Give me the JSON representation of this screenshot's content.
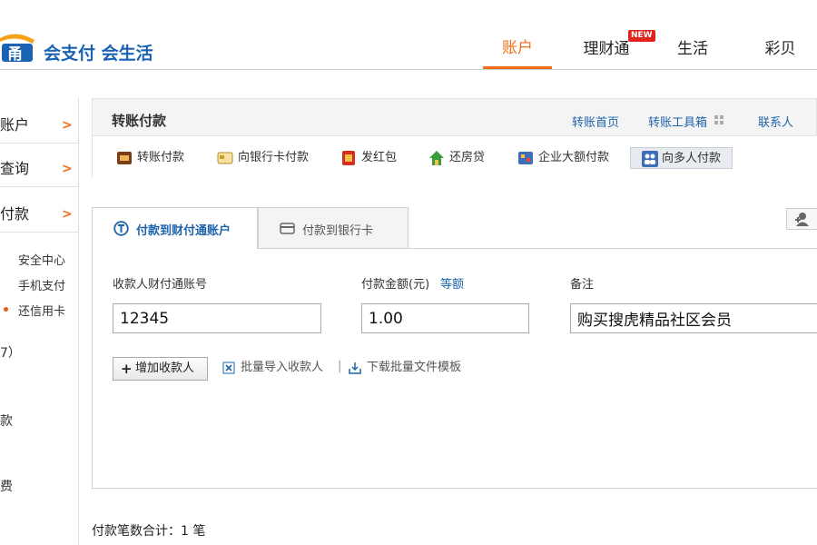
{
  "header": {
    "slogan": "会支付 会生活",
    "nav": [
      {
        "label": "账户",
        "active": true
      },
      {
        "label": "理财通"
      },
      {
        "label": "生活"
      },
      {
        "label": "彩贝"
      }
    ],
    "new_badge": "NEW",
    "accent_color": "#f06d1a",
    "brand_color": "#1a63b3"
  },
  "sidebar": {
    "items": [
      {
        "label": "账户"
      },
      {
        "label": "查询"
      },
      {
        "label": "付款"
      }
    ],
    "sub_items": [
      "安全中心",
      "手机支付",
      "还信用卡"
    ],
    "fragments": [
      "7）",
      "款",
      "费"
    ]
  },
  "main": {
    "title": "转账付款",
    "links": [
      "转账首页",
      "转账工具箱",
      "联系人"
    ],
    "tools": [
      {
        "label": "转账付款",
        "icon": "transfer-icon"
      },
      {
        "label": "向银行卡付款",
        "icon": "bank-card-icon"
      },
      {
        "label": "发红包",
        "icon": "red-envelope-icon"
      },
      {
        "label": "还房贷",
        "icon": "house-icon"
      },
      {
        "label": "企业大额付款",
        "icon": "enterprise-icon"
      },
      {
        "label": "向多人付款",
        "icon": "multi-user-icon",
        "active": true
      }
    ],
    "tabs": [
      {
        "label": "付款到财付通账户",
        "active": true
      },
      {
        "label": "付款到银行卡"
      }
    ]
  },
  "form": {
    "account_label": "收款人财付通账号",
    "account_value": "12345",
    "amount_label": "付款金额(元)",
    "equal_amount_link": "等额",
    "amount_value": "1.00",
    "remark_label": "备注",
    "remark_value": "购买搜虎精品社区会员",
    "add_payee_button": "增加收款人",
    "batch_import": "批量导入收款人",
    "download_template": "下载批量文件模板",
    "separator": "|"
  },
  "footer": {
    "count_text": "付款笔数合计：1 笔"
  }
}
